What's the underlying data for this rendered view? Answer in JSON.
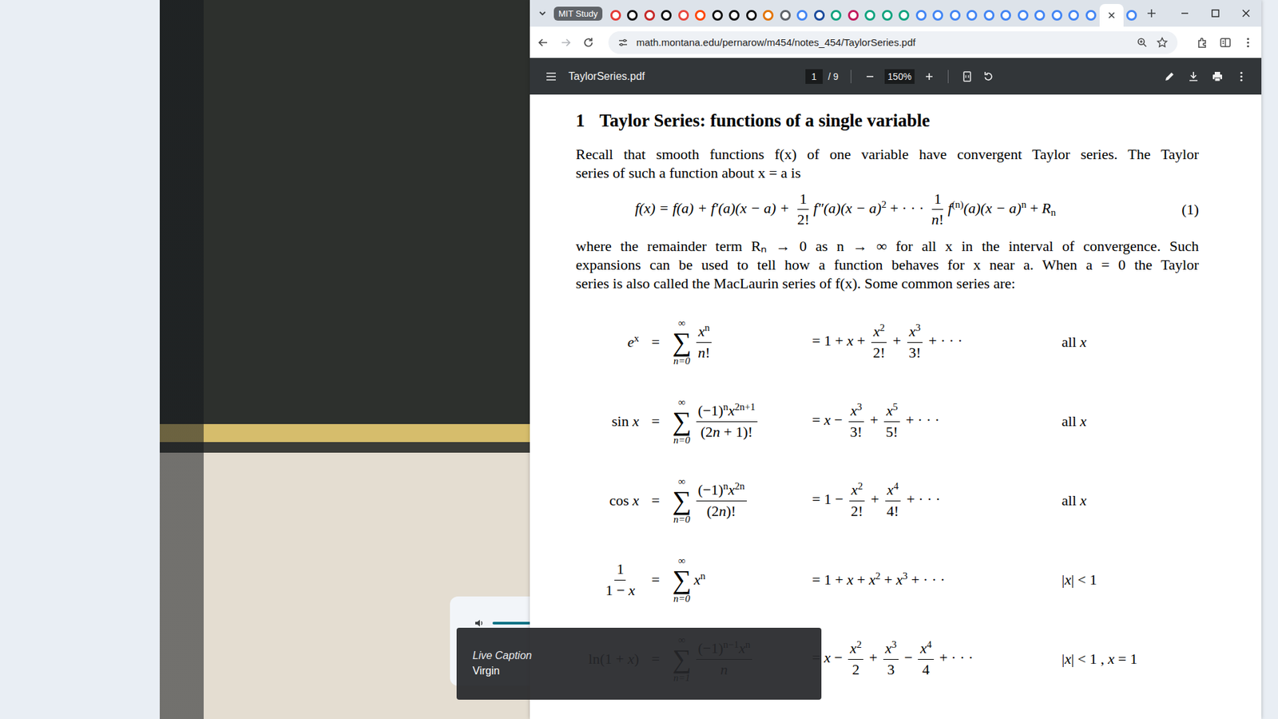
{
  "browser": {
    "tab_group": {
      "label": "MIT Study"
    },
    "tabs": [
      {
        "selected": false,
        "color": "#e53935"
      },
      {
        "selected": false,
        "color": "#111111"
      },
      {
        "selected": false,
        "color": "#c62828"
      },
      {
        "selected": false,
        "color": "#111111"
      },
      {
        "selected": false,
        "color": "#e8453c"
      },
      {
        "selected": false,
        "color": "#ff4500"
      },
      {
        "selected": false,
        "color": "#111111"
      },
      {
        "selected": false,
        "color": "#111111"
      },
      {
        "selected": false,
        "color": "#111111"
      },
      {
        "selected": false,
        "color": "#e37400"
      },
      {
        "selected": false,
        "color": "#5f6368"
      },
      {
        "selected": false,
        "color": "#4285f4"
      },
      {
        "selected": false,
        "color": "#1a4a9c"
      },
      {
        "selected": false,
        "color": "#10a37f"
      },
      {
        "selected": false,
        "color": "#c2185b"
      },
      {
        "selected": false,
        "color": "#10a37f"
      },
      {
        "selected": false,
        "color": "#10a37f"
      },
      {
        "selected": false,
        "color": "#10a37f"
      },
      {
        "selected": false,
        "color": "#4285f4"
      },
      {
        "selected": false,
        "color": "#4285f4"
      },
      {
        "selected": false,
        "color": "#4285f4"
      },
      {
        "selected": false,
        "color": "#4285f4"
      },
      {
        "selected": false,
        "color": "#4285f4"
      },
      {
        "selected": false,
        "color": "#4285f4"
      },
      {
        "selected": false,
        "color": "#4285f4"
      },
      {
        "selected": false,
        "color": "#4285f4"
      },
      {
        "selected": false,
        "color": "#4285f4"
      },
      {
        "selected": false,
        "color": "#4285f4"
      },
      {
        "selected": false,
        "color": "#4285f4"
      },
      {
        "selected": true
      },
      {
        "selected": false,
        "color": "#4285f4"
      }
    ],
    "url": "math.montana.edu/pernarow/m454/notes_454/TaylorSeries.pdf"
  },
  "pdf_toolbar": {
    "title": "TaylorSeries.pdf",
    "page": "1",
    "page_total": "/ 9",
    "zoom": "150%"
  },
  "document": {
    "section_number": "1",
    "section_title": "Taylor Series: functions of a single variable",
    "paragraph1": [
      "Recall that smooth functions f(x) of one variable have convergent Taylor series. The Taylor",
      "series of such a function about x = a is"
    ],
    "equation": {
      "tokens": [
        {
          "kind": "v",
          "text": "f(x) = f(a) + f′(a)(x − a) + "
        },
        {
          "kind": "frac",
          "num": [
            {
              "kind": "t",
              "text": "1"
            }
          ],
          "den": [
            {
              "kind": "t",
              "text": "2!"
            }
          ]
        },
        {
          "kind": "v",
          "text": "f″(a)(x − a)"
        },
        {
          "kind": "sup",
          "text": "2"
        },
        {
          "kind": "t",
          "text": " + · · · "
        },
        {
          "kind": "frac",
          "num": [
            {
              "kind": "t",
              "text": "1"
            }
          ],
          "den": [
            {
              "kind": "v",
              "text": "n"
            },
            {
              "kind": "t",
              "text": "!"
            }
          ]
        },
        {
          "kind": "v",
          "text": "f"
        },
        {
          "kind": "sup",
          "text": "(n)"
        },
        {
          "kind": "v",
          "text": "(a)(x − a)"
        },
        {
          "kind": "sup",
          "text": "n"
        },
        {
          "kind": "t",
          "text": " + "
        },
        {
          "kind": "v",
          "text": "R"
        },
        {
          "kind": "sub",
          "text": "n"
        }
      ],
      "number": "(1)"
    },
    "paragraph2": [
      "where the remainder term Rₙ → 0 as n → ∞ for all x in the interval of convergence. Such",
      "expansions can be used to tell how a function behaves for x near a. When a = 0 the Taylor",
      "series is also called the MacLaurin series of f(x). Some common series are:"
    ],
    "series": [
      {
        "lhs": [
          {
            "kind": "v",
            "text": "e"
          },
          {
            "kind": "sup",
            "text": "x"
          }
        ],
        "equals": "=",
        "sum": {
          "top": "∞",
          "sign": "∑",
          "bottom": "n=0"
        },
        "term": [
          {
            "kind": "frac",
            "num": [
              {
                "kind": "v",
                "text": "x"
              },
              {
                "kind": "sup",
                "text": "n"
              }
            ],
            "den": [
              {
                "kind": "v",
                "text": "n"
              },
              {
                "kind": "t",
                "text": "!"
              }
            ]
          }
        ],
        "expansion": [
          {
            "kind": "t",
            "text": "= 1 + "
          },
          {
            "kind": "v",
            "text": "x"
          },
          {
            "kind": "t",
            "text": " + "
          },
          {
            "kind": "frac",
            "num": [
              {
                "kind": "v",
                "text": "x"
              },
              {
                "kind": "sup",
                "text": "2"
              }
            ],
            "den": [
              {
                "kind": "t",
                "text": "2!"
              }
            ]
          },
          {
            "kind": "t",
            "text": " + "
          },
          {
            "kind": "frac",
            "num": [
              {
                "kind": "v",
                "text": "x"
              },
              {
                "kind": "sup",
                "text": "3"
              }
            ],
            "den": [
              {
                "kind": "t",
                "text": "3!"
              }
            ]
          },
          {
            "kind": "t",
            "text": " + · · ·"
          }
        ],
        "domain": [
          {
            "kind": "t",
            "text": "all "
          },
          {
            "kind": "v",
            "text": "x"
          }
        ]
      },
      {
        "lhs": [
          {
            "kind": "t",
            "text": "sin "
          },
          {
            "kind": "v",
            "text": "x"
          }
        ],
        "equals": "=",
        "sum": {
          "top": "∞",
          "sign": "∑",
          "bottom": "n=0"
        },
        "term": [
          {
            "kind": "frac",
            "num": [
              {
                "kind": "t",
                "text": "(−1)"
              },
              {
                "kind": "sup",
                "text": "n"
              },
              {
                "kind": "v",
                "text": "x"
              },
              {
                "kind": "sup",
                "text": "2n+1"
              }
            ],
            "den": [
              {
                "kind": "t",
                "text": "(2"
              },
              {
                "kind": "v",
                "text": "n"
              },
              {
                "kind": "t",
                "text": " + 1)!"
              }
            ]
          }
        ],
        "expansion": [
          {
            "kind": "t",
            "text": "= "
          },
          {
            "kind": "v",
            "text": "x"
          },
          {
            "kind": "t",
            "text": " − "
          },
          {
            "kind": "frac",
            "num": [
              {
                "kind": "v",
                "text": "x"
              },
              {
                "kind": "sup",
                "text": "3"
              }
            ],
            "den": [
              {
                "kind": "t",
                "text": "3!"
              }
            ]
          },
          {
            "kind": "t",
            "text": " + "
          },
          {
            "kind": "frac",
            "num": [
              {
                "kind": "v",
                "text": "x"
              },
              {
                "kind": "sup",
                "text": "5"
              }
            ],
            "den": [
              {
                "kind": "t",
                "text": "5!"
              }
            ]
          },
          {
            "kind": "t",
            "text": " + · · ·"
          }
        ],
        "domain": [
          {
            "kind": "t",
            "text": "all "
          },
          {
            "kind": "v",
            "text": "x"
          }
        ]
      },
      {
        "lhs": [
          {
            "kind": "t",
            "text": "cos "
          },
          {
            "kind": "v",
            "text": "x"
          }
        ],
        "equals": "=",
        "sum": {
          "top": "∞",
          "sign": "∑",
          "bottom": "n=0"
        },
        "term": [
          {
            "kind": "frac",
            "num": [
              {
                "kind": "t",
                "text": "(−1)"
              },
              {
                "kind": "sup",
                "text": "n"
              },
              {
                "kind": "v",
                "text": "x"
              },
              {
                "kind": "sup",
                "text": "2n"
              }
            ],
            "den": [
              {
                "kind": "t",
                "text": "(2"
              },
              {
                "kind": "v",
                "text": "n"
              },
              {
                "kind": "t",
                "text": ")!"
              }
            ]
          }
        ],
        "expansion": [
          {
            "kind": "t",
            "text": "= 1 − "
          },
          {
            "kind": "frac",
            "num": [
              {
                "kind": "v",
                "text": "x"
              },
              {
                "kind": "sup",
                "text": "2"
              }
            ],
            "den": [
              {
                "kind": "t",
                "text": "2!"
              }
            ]
          },
          {
            "kind": "t",
            "text": " + "
          },
          {
            "kind": "frac",
            "num": [
              {
                "kind": "v",
                "text": "x"
              },
              {
                "kind": "sup",
                "text": "4"
              }
            ],
            "den": [
              {
                "kind": "t",
                "text": "4!"
              }
            ]
          },
          {
            "kind": "t",
            "text": " + · · ·"
          }
        ],
        "domain": [
          {
            "kind": "t",
            "text": "all "
          },
          {
            "kind": "v",
            "text": "x"
          }
        ]
      },
      {
        "lhs": [
          {
            "kind": "frac",
            "num": [
              {
                "kind": "t",
                "text": "1"
              }
            ],
            "den": [
              {
                "kind": "t",
                "text": "1 − "
              },
              {
                "kind": "v",
                "text": "x"
              }
            ]
          }
        ],
        "equals": "=",
        "sum": {
          "top": "∞",
          "sign": "∑",
          "bottom": "n=0"
        },
        "term": [
          {
            "kind": "v",
            "text": "x"
          },
          {
            "kind": "sup",
            "text": "n"
          }
        ],
        "expansion": [
          {
            "kind": "t",
            "text": "= 1 + "
          },
          {
            "kind": "v",
            "text": "x"
          },
          {
            "kind": "t",
            "text": " + "
          },
          {
            "kind": "v",
            "text": "x"
          },
          {
            "kind": "sup",
            "text": "2"
          },
          {
            "kind": "t",
            "text": " + "
          },
          {
            "kind": "v",
            "text": "x"
          },
          {
            "kind": "sup",
            "text": "3"
          },
          {
            "kind": "t",
            "text": " + · · ·"
          }
        ],
        "domain": [
          {
            "kind": "t",
            "text": "|"
          },
          {
            "kind": "v",
            "text": "x"
          },
          {
            "kind": "t",
            "text": "| < 1"
          }
        ]
      },
      {
        "lhs": [
          {
            "kind": "t",
            "text": "ln(1 + "
          },
          {
            "kind": "v",
            "text": "x"
          },
          {
            "kind": "t",
            "text": ")"
          }
        ],
        "equals": "=",
        "sum": {
          "top": "∞",
          "sign": "∑",
          "bottom": "n=1"
        },
        "term": [
          {
            "kind": "frac",
            "num": [
              {
                "kind": "t",
                "text": "(−1)"
              },
              {
                "kind": "sup",
                "text": "n−1"
              },
              {
                "kind": "v",
                "text": "x"
              },
              {
                "kind": "sup",
                "text": "n"
              }
            ],
            "den": [
              {
                "kind": "v",
                "text": "n"
              }
            ]
          }
        ],
        "expansion": [
          {
            "kind": "t",
            "text": "= "
          },
          {
            "kind": "v",
            "text": "x"
          },
          {
            "kind": "t",
            "text": " − "
          },
          {
            "kind": "frac",
            "num": [
              {
                "kind": "v",
                "text": "x"
              },
              {
                "kind": "sup",
                "text": "2"
              }
            ],
            "den": [
              {
                "kind": "t",
                "text": "2"
              }
            ]
          },
          {
            "kind": "t",
            "text": " + "
          },
          {
            "kind": "frac",
            "num": [
              {
                "kind": "v",
                "text": "x"
              },
              {
                "kind": "sup",
                "text": "3"
              }
            ],
            "den": [
              {
                "kind": "t",
                "text": "3"
              }
            ]
          },
          {
            "kind": "t",
            "text": " − "
          },
          {
            "kind": "frac",
            "num": [
              {
                "kind": "v",
                "text": "x"
              },
              {
                "kind": "sup",
                "text": "4"
              }
            ],
            "den": [
              {
                "kind": "t",
                "text": "4"
              }
            ]
          },
          {
            "kind": "t",
            "text": " + · · ·"
          }
        ],
        "domain": [
          {
            "kind": "t",
            "text": "|"
          },
          {
            "kind": "v",
            "text": "x"
          },
          {
            "kind": "t",
            "text": "| < 1 , "
          },
          {
            "kind": "v",
            "text": "x"
          },
          {
            "kind": "t",
            "text": " = 1"
          }
        ]
      }
    ]
  },
  "media_control": {
    "level": 0.8
  },
  "live_caption": {
    "title": "Live Caption",
    "text": "Virgin"
  }
}
